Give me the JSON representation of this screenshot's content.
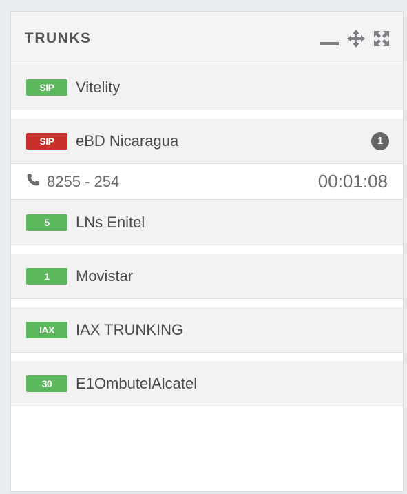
{
  "panel": {
    "title": "TRUNKS",
    "tools": {
      "minimize": "minimize-icon",
      "move": "move-icon",
      "fullscreen": "expand-icon"
    }
  },
  "trunks": [
    {
      "badge": "SIP",
      "badge_color": "#5cb85c",
      "name": "Vitelity"
    },
    {
      "badge": "SIP",
      "badge_color": "#c9302c",
      "name": "eBD Nicaragua",
      "active_calls": "1",
      "call": {
        "icon": "phone-icon",
        "number": "8255 - 254",
        "duration": "00:01:08"
      }
    },
    {
      "badge": "5",
      "badge_color": "#5cb85c",
      "name": "LNs Enitel"
    },
    {
      "badge": "1",
      "badge_color": "#5cb85c",
      "name": "Movistar"
    },
    {
      "badge": "IAX",
      "badge_color": "#5cb85c",
      "name": "IAX TRUNKING"
    },
    {
      "badge": "30",
      "badge_color": "#5cb85c",
      "name": "E1OmbutelAlcatel"
    }
  ]
}
